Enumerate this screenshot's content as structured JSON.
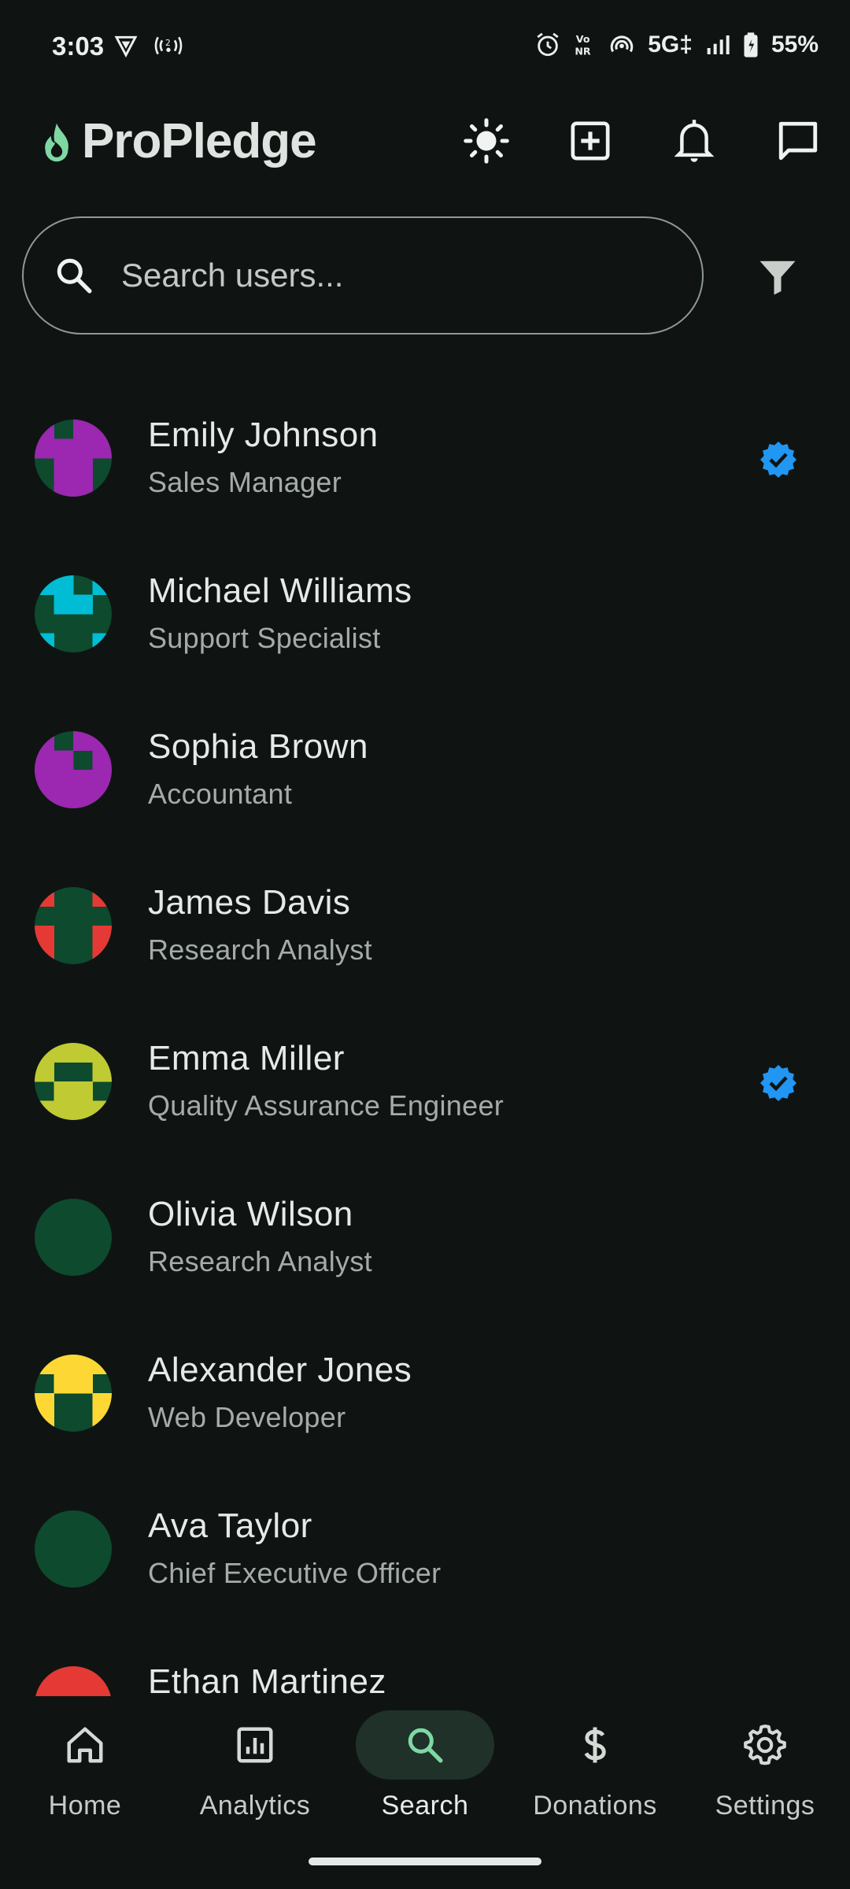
{
  "status_bar": {
    "time": "3:03",
    "network": "5G‡",
    "volte": "Vo\nNR",
    "battery": "55%"
  },
  "app": {
    "title": "ProPledge",
    "actions": [
      {
        "icon": "brightness-icon",
        "label": "Toggle theme"
      },
      {
        "icon": "add-box-icon",
        "label": "Create"
      },
      {
        "icon": "bell-icon",
        "label": "Notifications"
      },
      {
        "icon": "chat-icon",
        "label": "Messages"
      }
    ]
  },
  "search": {
    "placeholder": "Search users...",
    "value": ""
  },
  "users": [
    {
      "name": "Emily Johnson",
      "role": "Sales Manager",
      "verified": true,
      "color": "#9c27b0"
    },
    {
      "name": "Michael Williams",
      "role": "Support Specialist",
      "verified": false,
      "color": "#00bcd4"
    },
    {
      "name": "Sophia Brown",
      "role": "Accountant",
      "verified": false,
      "color": "#9c27b0"
    },
    {
      "name": "James Davis",
      "role": "Research Analyst",
      "verified": false,
      "color": "#e53935"
    },
    {
      "name": "Emma Miller",
      "role": "Quality Assurance Engineer",
      "verified": true,
      "color": "#c0ca33"
    },
    {
      "name": "Olivia Wilson",
      "role": "Research Analyst",
      "verified": false,
      "color": "#0d4a2e"
    },
    {
      "name": "Alexander Jones",
      "role": "Web Developer",
      "verified": false,
      "color": "#fdd835"
    },
    {
      "name": "Ava Taylor",
      "role": "Chief Executive Officer",
      "verified": false,
      "color": "#0d4a2e"
    },
    {
      "name": "Ethan Martinez",
      "role": "",
      "verified": false,
      "color": "#e53935"
    }
  ],
  "colors": {
    "background": "#0f1412",
    "avatar_base": "#0d4a2e",
    "verified": "#2196f3",
    "accent": "#7fd8a4",
    "nav_active_pill": "#1f3129"
  },
  "nav": {
    "items": [
      {
        "label": "Home",
        "icon": "home-icon",
        "active": false
      },
      {
        "label": "Analytics",
        "icon": "analytics-icon",
        "active": false
      },
      {
        "label": "Search",
        "icon": "search-icon",
        "active": true
      },
      {
        "label": "Donations",
        "icon": "dollar-icon",
        "active": false
      },
      {
        "label": "Settings",
        "icon": "gear-icon",
        "active": false
      }
    ]
  }
}
